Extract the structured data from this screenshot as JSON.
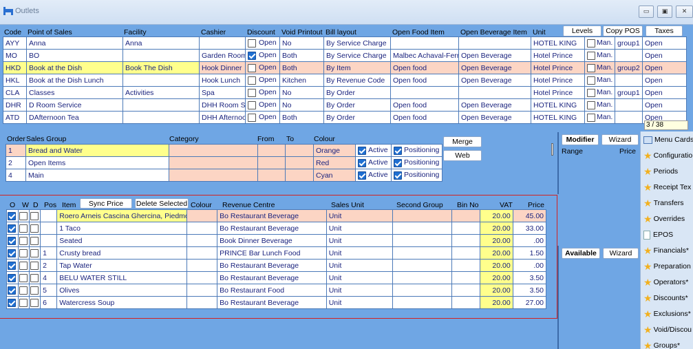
{
  "window": {
    "title": "Outlets",
    "min": "▭",
    "max": "▣",
    "close": "✕"
  },
  "outlets": {
    "headers": {
      "code": "Code",
      "pos": "Point of Sales",
      "facility": "Facility",
      "cashier": "Cashier",
      "discount": "Discount",
      "void": "Void Printout",
      "bill": "Bill layout",
      "food": "Open Food Item",
      "bev": "Open Beverage Item",
      "unit": "Unit"
    },
    "buttons": {
      "levels": "Levels",
      "copy": "Copy POS",
      "taxes": "Taxes"
    },
    "rows": [
      {
        "code": "AYY",
        "pos": "Anna",
        "facility": "Anna",
        "cashier": "",
        "discount": false,
        "open": "Open",
        "void": "No",
        "bill": "By Service Charge",
        "food": "",
        "bev": "",
        "unit": "HOTEL KING",
        "man": "Man.",
        "group": "group1",
        "tax": "Open"
      },
      {
        "code": "MO",
        "pos": "BO",
        "facility": "",
        "cashier": "Garden Room",
        "discount": true,
        "open": "Open",
        "void": "Both",
        "bill": "By Service Charge",
        "food": "Malbec Achaval-Ferr",
        "bev": "Open Beverage",
        "unit": "Hotel Prince",
        "man": "Man.",
        "group": "",
        "tax": "Open"
      },
      {
        "code": "HKD",
        "pos": "Book at the Dish",
        "facility": "Book The Dish",
        "cashier": "Hook Dinner",
        "discount": false,
        "open": "Open",
        "void": "Both",
        "bill": "By Item",
        "food": "Open food",
        "bev": "Open Beverage",
        "unit": "Hotel Prince",
        "man": "Man.",
        "group": "group2",
        "tax": "Open"
      },
      {
        "code": "HKL",
        "pos": "Book at the Dish Lunch",
        "facility": "",
        "cashier": "Hook Lunch",
        "discount": false,
        "open": "Open",
        "void": "Kitchen",
        "bill": "By Revenue Code",
        "food": "Open food",
        "bev": "Open Beverage",
        "unit": "Hotel Prince",
        "man": "Man.",
        "group": "",
        "tax": "Open"
      },
      {
        "code": "CLA",
        "pos": "Classes",
        "facility": "Activities",
        "cashier": "Spa",
        "discount": false,
        "open": "Open",
        "void": "No",
        "bill": "By Order",
        "food": "",
        "bev": "",
        "unit": "Hotel Prince",
        "man": "Man.",
        "group": "group1",
        "tax": "Open"
      },
      {
        "code": "DHR",
        "pos": "D Room Service",
        "facility": "",
        "cashier": "DHH Room Se",
        "discount": false,
        "open": "Open",
        "void": "No",
        "bill": "By Order",
        "food": "Open food",
        "bev": "Open Beverage",
        "unit": "HOTEL KING",
        "man": "Man.",
        "group": "",
        "tax": "Open"
      },
      {
        "code": "ATD",
        "pos": "DAfternoon Tea",
        "facility": "",
        "cashier": "DHH Afternoo",
        "discount": false,
        "open": "Open",
        "void": "Both",
        "bill": "By Order",
        "food": "Open food",
        "bev": "Open Beverage",
        "unit": "HOTEL KING",
        "man": "Man.",
        "group": "",
        "tax": "Open"
      }
    ],
    "pager": "3 / 38"
  },
  "sales_groups": {
    "headers": {
      "order": "Order",
      "group": "Sales Group",
      "category": "Category",
      "from": "From",
      "to": "To",
      "colour": "Colour"
    },
    "buttons": {
      "merge": "Merge",
      "web": "Web"
    },
    "rows": [
      {
        "order": "1",
        "name": "Bread and Water",
        "colour": "Orange",
        "active": "Active",
        "positioning": "Positioning"
      },
      {
        "order": "2",
        "name": "Open Items",
        "colour": "Red",
        "active": "Active",
        "positioning": "Positioning"
      },
      {
        "order": "4",
        "name": "Main",
        "colour": "Cyan",
        "active": "Active",
        "positioning": "Positioning"
      }
    ]
  },
  "modifier": {
    "tab": "Modifier",
    "wizard": "Wizard",
    "range": "Range",
    "price": "Price"
  },
  "available": {
    "tab": "Available",
    "wizard": "Wizard"
  },
  "items": {
    "headers": {
      "o": "O",
      "w": "W",
      "d": "D",
      "pos": "Pos",
      "item": "Item",
      "colour": "Colour",
      "revenue": "Revenue Centre",
      "unit": "Sales Unit",
      "second": "Second Group",
      "bin": "Bin No",
      "vat": "VAT",
      "price": "Price"
    },
    "buttons": {
      "sync": "Sync Price",
      "delete": "Delete Selected"
    },
    "rows": [
      {
        "pos": "",
        "item": "Roero Arneis Cascina Ghercina, Piedmo",
        "revenue": "Bo Restaurant Beverage",
        "unit": "Unit",
        "vat": "20.00",
        "price": "45.00"
      },
      {
        "pos": "",
        "item": "1 Taco",
        "revenue": "Bo Restaurant Beverage",
        "unit": "Unit",
        "vat": "20.00",
        "price": "33.00"
      },
      {
        "pos": "",
        "item": "Seated",
        "revenue": "Book Dinner Beverage",
        "unit": "Unit",
        "vat": "20.00",
        "price": ".00"
      },
      {
        "pos": "1",
        "item": "Crusty bread",
        "revenue": "PRINCE Bar Lunch Food",
        "unit": "Unit",
        "vat": "20.00",
        "price": "1.50"
      },
      {
        "pos": "2",
        "item": "Tap Water",
        "revenue": "Bo Restaurant Beverage",
        "unit": "Unit",
        "vat": "20.00",
        "price": ".00"
      },
      {
        "pos": "4",
        "item": "BELU WATER STILL",
        "revenue": "Bo Restaurant Beverage",
        "unit": "Unit",
        "vat": "20.00",
        "price": "3.50"
      },
      {
        "pos": "5",
        "item": "Olives",
        "revenue": "Bo Restaurant Food",
        "unit": "Unit",
        "vat": "20.00",
        "price": "3.50"
      },
      {
        "pos": "6",
        "item": "Watercress Soup",
        "revenue": "Bo Restaurant Beverage",
        "unit": "Unit",
        "vat": "20.00",
        "price": "27.00"
      }
    ]
  },
  "sidebar": [
    {
      "label": "Menu Cards",
      "icon": "menu-cards-icon"
    },
    {
      "label": "Configuratio",
      "icon": "star-icon"
    },
    {
      "label": "Periods",
      "icon": "star-icon"
    },
    {
      "label": "Receipt Tex",
      "icon": "star-icon"
    },
    {
      "label": "Transfers",
      "icon": "star-icon"
    },
    {
      "label": "Overrides",
      "icon": "star-icon"
    },
    {
      "label": "EPOS",
      "icon": "page-icon"
    },
    {
      "label": "Financials*",
      "icon": "star-icon"
    },
    {
      "label": "Preparation",
      "icon": "star-icon"
    },
    {
      "label": "Operators*",
      "icon": "star-icon"
    },
    {
      "label": "Discounts*",
      "icon": "star-icon"
    },
    {
      "label": "Exclusions*",
      "icon": "star-icon"
    },
    {
      "label": "Void/Discou",
      "icon": "star-icon"
    },
    {
      "label": "Groups*",
      "icon": "star-icon"
    }
  ],
  "colors": {
    "panel": "#6fa6e4",
    "highlight": "#fcd5c4",
    "yellow": "#ffff8c",
    "selection": "#d22020",
    "text": "#1a237e"
  }
}
